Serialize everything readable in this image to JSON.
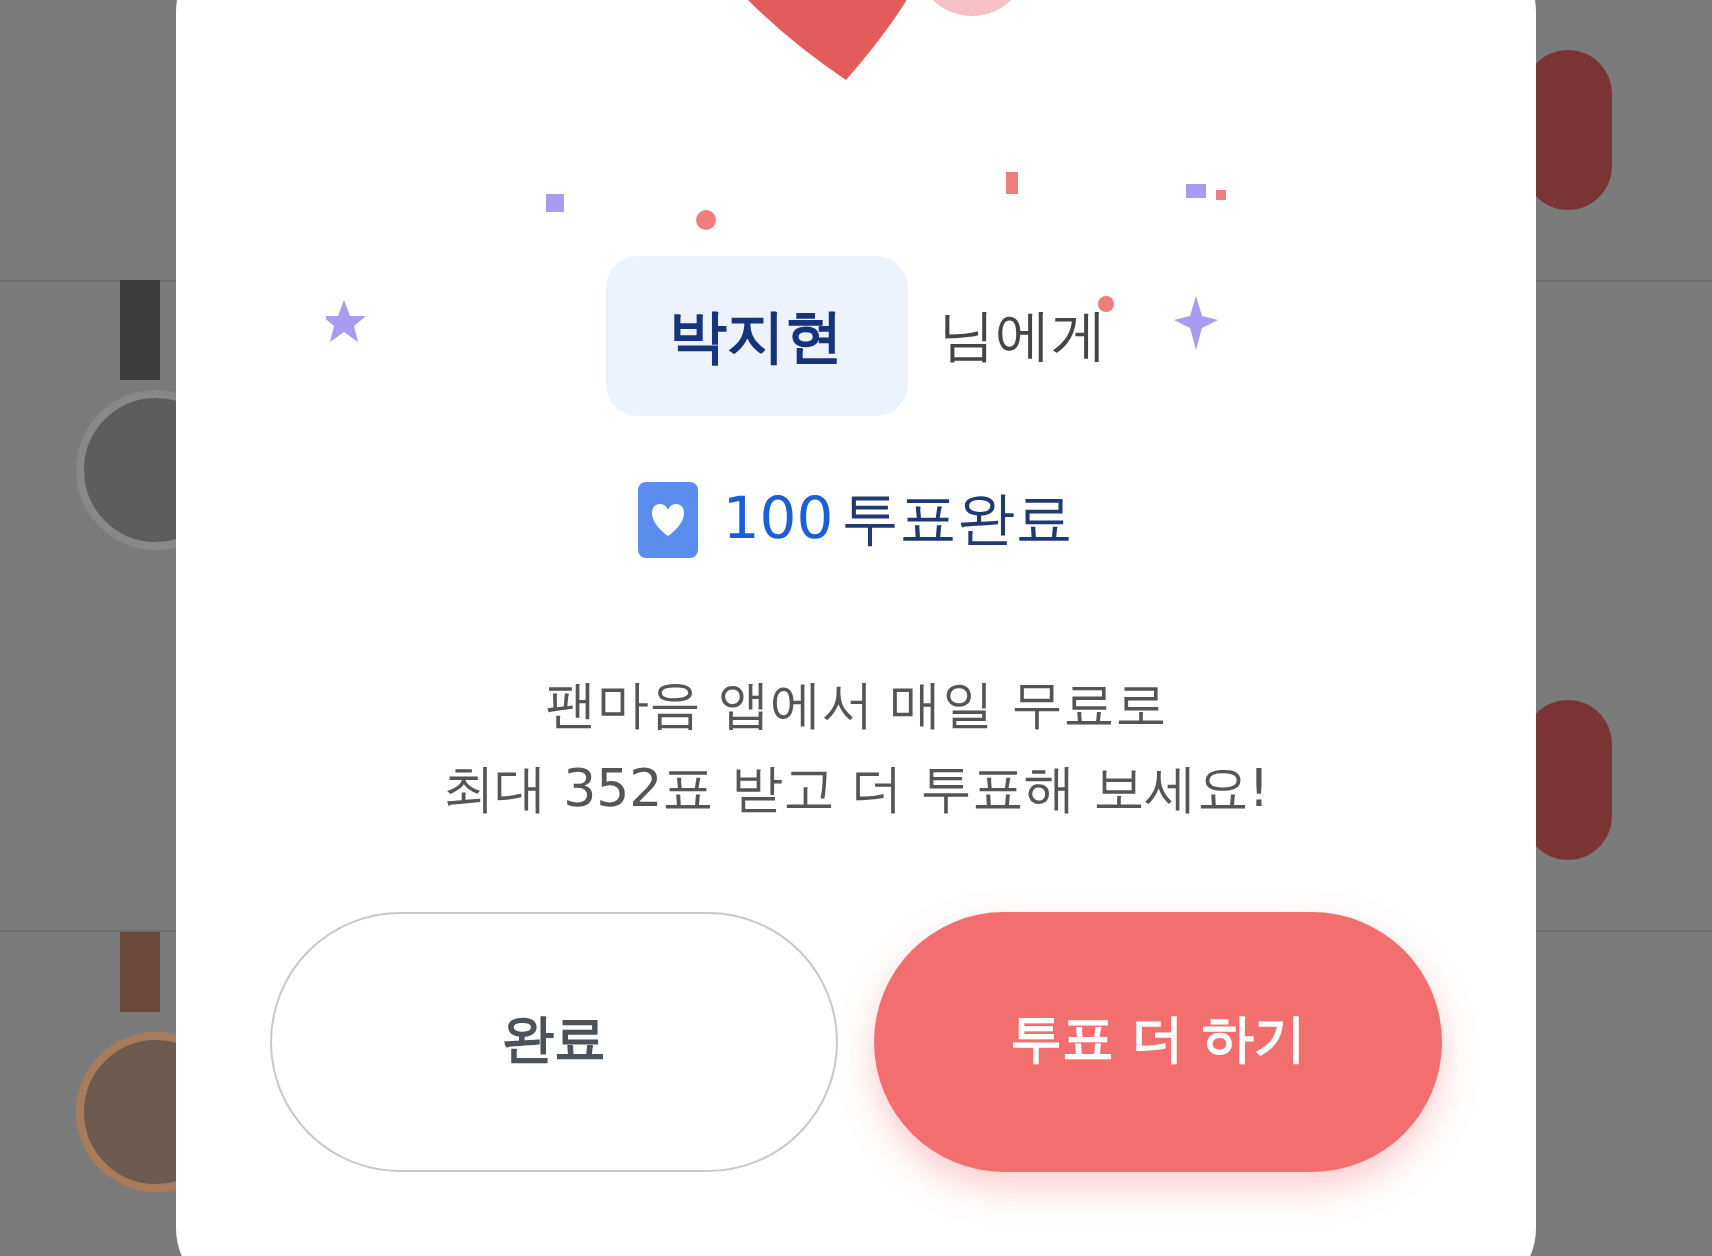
{
  "dialog": {
    "recipient": "박지현",
    "recipient_suffix": "님에게",
    "vote_count": "100",
    "vote_label": "투표완료",
    "message": "팬마음 앱에서 매일 무료로\n최대 352표 받고 더 투표해 보세요!",
    "buttons": [
      {
        "label": "완료",
        "kind": "secondary"
      },
      {
        "label": "투표 더 하기",
        "kind": "primary"
      }
    ]
  }
}
